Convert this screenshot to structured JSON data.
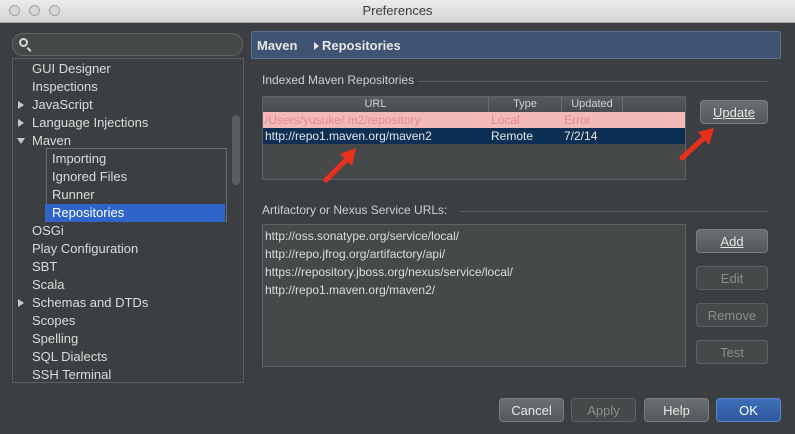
{
  "window": {
    "title": "Preferences"
  },
  "search": {
    "placeholder": ""
  },
  "sidebar": {
    "items": [
      {
        "label": "GUI Designer",
        "arrow": ""
      },
      {
        "label": "Inspections",
        "arrow": ""
      },
      {
        "label": "JavaScript",
        "arrow": "right"
      },
      {
        "label": "Language Injections",
        "arrow": "right"
      },
      {
        "label": "Maven",
        "arrow": "down"
      },
      {
        "label": "Importing",
        "arrow": ""
      },
      {
        "label": "Ignored Files",
        "arrow": ""
      },
      {
        "label": "Runner",
        "arrow": ""
      },
      {
        "label": "Repositories",
        "arrow": "",
        "selected": true
      },
      {
        "label": "OSGi",
        "arrow": ""
      },
      {
        "label": "Play Configuration",
        "arrow": ""
      },
      {
        "label": "SBT",
        "arrow": ""
      },
      {
        "label": "Scala",
        "arrow": ""
      },
      {
        "label": "Schemas and DTDs",
        "arrow": "right"
      },
      {
        "label": "Scopes",
        "arrow": ""
      },
      {
        "label": "Spelling",
        "arrow": ""
      },
      {
        "label": "SQL Dialects",
        "arrow": ""
      },
      {
        "label": "SSH Terminal",
        "arrow": ""
      }
    ]
  },
  "breadcrumb": {
    "parent": "Maven",
    "current": "Repositories"
  },
  "indexed": {
    "title": "Indexed Maven Repositories",
    "columns": [
      "URL",
      "Type",
      "Updated"
    ],
    "rows": [
      {
        "url": "/Users/yusuke/.m2/repository",
        "type": "Local",
        "updated": "Error"
      },
      {
        "url": "http://repo1.maven.org/maven2",
        "type": "Remote",
        "updated": "7/2/14"
      }
    ],
    "update_button": "Update"
  },
  "artifactory": {
    "title": "Artifactory or Nexus Service URLs:",
    "urls": [
      "http://oss.sonatype.org/service/local/",
      "http://repo.jfrog.org/artifactory/api/",
      "https://repository.jboss.org/nexus/service/local/",
      "http://repo1.maven.org/maven2/"
    ],
    "buttons": {
      "add": "Add",
      "edit": "Edit",
      "remove": "Remove",
      "test": "Test"
    }
  },
  "footer": {
    "cancel": "Cancel",
    "apply": "Apply",
    "help": "Help",
    "ok": "OK"
  },
  "colors": {
    "selection": "#2f65ca",
    "error_row_bg": "#f2b9bb",
    "selected_row_bg": "#0c2f53",
    "header_bg": "#3e5472",
    "annotation_arrow": "#e8301c"
  }
}
